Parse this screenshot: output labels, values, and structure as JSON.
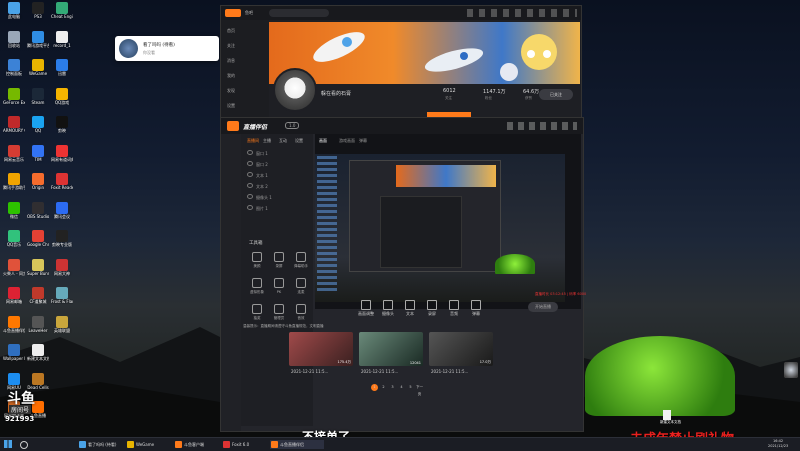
{
  "desktop": {
    "icons": [
      {
        "label": "此电脑",
        "color": "#4aa3e8"
      },
      {
        "label": "回收站",
        "color": "#9aa7b8"
      },
      {
        "label": "控制面板",
        "color": "#3c82d6"
      },
      {
        "label": "GeForce Experience",
        "color": "#76b900"
      },
      {
        "label": "ARMOURY CRATE",
        "color": "#c0292a"
      },
      {
        "label": "网易云音乐",
        "color": "#d43c33"
      },
      {
        "label": "腾讯手游助手",
        "color": "#f0a400"
      },
      {
        "label": "微信",
        "color": "#2dc100"
      },
      {
        "label": "QQ音乐",
        "color": "#31c27c"
      },
      {
        "label": "火柴人 - 同步",
        "color": "#e0523a"
      },
      {
        "label": "网易邮箱",
        "color": "#d23"
      },
      {
        "label": "斗鱼直播伴侣",
        "color": "#ff7800"
      },
      {
        "label": "Wallpaper Engine",
        "color": "#2f6fbf"
      },
      {
        "label": "网易UU",
        "color": "#1c8df0"
      },
      {
        "label": "网易加速器",
        "color": "#c62"
      },
      {
        "label": "PS3",
        "color": "#222"
      },
      {
        "label": "腾讯游戏平台",
        "color": "#2f8de4"
      },
      {
        "label": "WeGame",
        "color": "#e8b400"
      },
      {
        "label": "Steam",
        "color": "#1b2838"
      },
      {
        "label": "QQ",
        "color": "#1aa3f0"
      },
      {
        "label": "TIM",
        "color": "#3273f4"
      },
      {
        "label": "Origin",
        "color": "#f56c2d"
      },
      {
        "label": "OBS Studio",
        "color": "#302e31"
      },
      {
        "label": "Google Chrome",
        "color": "#e44134"
      },
      {
        "label": "Super Bunny Man",
        "color": "#d8c65a"
      },
      {
        "label": "CF道聚城",
        "color": "#c0392b"
      },
      {
        "label": "LeaveHer",
        "color": "#555"
      },
      {
        "label": "新建文本文档",
        "color": "#eee"
      },
      {
        "label": "Dead Cells",
        "color": "#b72"
      },
      {
        "label": "斗鱼直播",
        "color": "#ff6e00"
      },
      {
        "label": "Cheat Engine",
        "color": "#3a7"
      },
      {
        "label": "record_1",
        "color": "#eee"
      },
      {
        "label": "迅雷",
        "color": "#2b7de9"
      },
      {
        "label": "QQ游戏",
        "color": "#f4b400"
      },
      {
        "label": "剪映",
        "color": "#111"
      },
      {
        "label": "网易有道词典",
        "color": "#e33"
      },
      {
        "label": "Foxit Reader",
        "color": "#d33"
      },
      {
        "label": "腾讯会议",
        "color": "#2c6bf2"
      },
      {
        "label": "剪映专业版",
        "color": "#222"
      },
      {
        "label": "网易大神",
        "color": "#c33"
      },
      {
        "label": "Frost & Flame",
        "color": "#6ab"
      },
      {
        "label": "英雄联盟",
        "color": "#c9a63c"
      }
    ],
    "right_file": "新建文本文档"
  },
  "notification": {
    "title": "看了吗吗 (待看)",
    "subtitle": "你没看"
  },
  "profile_window": {
    "title": "鱼吧",
    "nav": [
      "首页",
      "关注",
      "消息",
      "我的",
      "发现",
      "设置"
    ],
    "user_name": "躲在看的石膏",
    "stats": [
      {
        "value": "6012",
        "label": "关注"
      },
      {
        "value": "1147.1万",
        "label": "粉丝"
      },
      {
        "value": "64.6万",
        "label": "获赞"
      }
    ],
    "follow_button": "已关注",
    "tab_label": "动态"
  },
  "live_window": {
    "logo": "直播伴侣",
    "badge": "1.0",
    "tabs": [
      "直播间",
      "主播",
      "互动",
      "设置"
    ],
    "scene_tabs": [
      "画面",
      "游戏画面",
      "弹幕"
    ],
    "sources": [
      "窗口 1",
      "窗口 2",
      "文本 1",
      "文本 2",
      "摄像头 1",
      "图片 1"
    ],
    "tools_title": "工具箱",
    "tools": [
      "美颜",
      "录屏",
      "弹幕助手",
      "虚拟形象",
      "PK",
      "连麦",
      "抽奖",
      "管理员",
      "音效"
    ],
    "control_buttons": [
      "画面调整",
      "摄像头",
      "文本",
      "录屏",
      "音频",
      "弹幕"
    ],
    "go_live": "开始直播",
    "status_text": "斗鱼直播伴侣 正在运行",
    "stream_info": "直播时长 03:12:45 | 码率 6000",
    "notice": "温馨提示：直播期间请遵守斗鱼直播规范，文明直播",
    "recommend": [
      {
        "date": "2021-12-21 11:5...",
        "views": "175.4万"
      },
      {
        "date": "2021-12-21 11:5...",
        "views": "12041"
      },
      {
        "date": "2021-12-21 11:5...",
        "views": "17.0万"
      }
    ],
    "pages": [
      "1",
      "2",
      "3",
      "4",
      "5",
      "下一页"
    ]
  },
  "taskbar": {
    "items": [
      "看了吗吗 (待看)",
      "WeGame",
      "斗鱼客户端",
      "Foxit 6.0",
      "斗鱼直播伴侣"
    ],
    "clock_time": "16:42",
    "clock_date": "2021/12/23"
  },
  "overlay": {
    "douyu_logo": "斗鱼",
    "room_label": "房间号",
    "room_id": "921993",
    "subtitle": "不接单了",
    "warning": "未成年禁止刷礼物"
  },
  "colors": {
    "accent": "#ff7a1a",
    "warning": "#e8201e"
  }
}
